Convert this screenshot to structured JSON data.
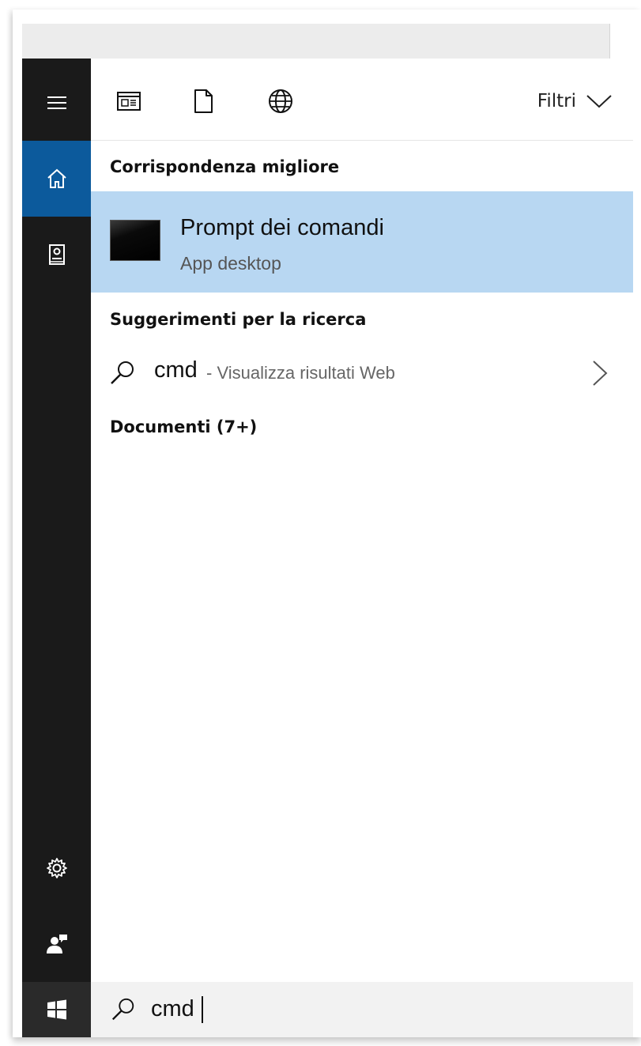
{
  "toolbar": {
    "icons": [
      "apps-icon",
      "document-icon",
      "web-icon"
    ],
    "filters_label": "Filtri"
  },
  "sidebar": {
    "icons": [
      "hamburger-icon",
      "home-icon",
      "notebook-icon",
      "gear-icon",
      "feedback-icon",
      "windows-logo-icon"
    ],
    "selected": "home"
  },
  "best_match": {
    "heading": "Corrispondenza migliore",
    "title": "Prompt dei comandi",
    "subtitle": "App desktop"
  },
  "suggestions": {
    "heading": "Suggerimenti per la ricerca",
    "query": "cmd",
    "description": "- Visualizza risultati Web"
  },
  "documents": {
    "heading": "Documenti (7+)"
  },
  "search": {
    "value": "cmd"
  },
  "colors": {
    "sidebar_bg": "#1a1a1a",
    "selected_bg": "#0c5a9c",
    "highlight_row": "#b8d7f2"
  }
}
